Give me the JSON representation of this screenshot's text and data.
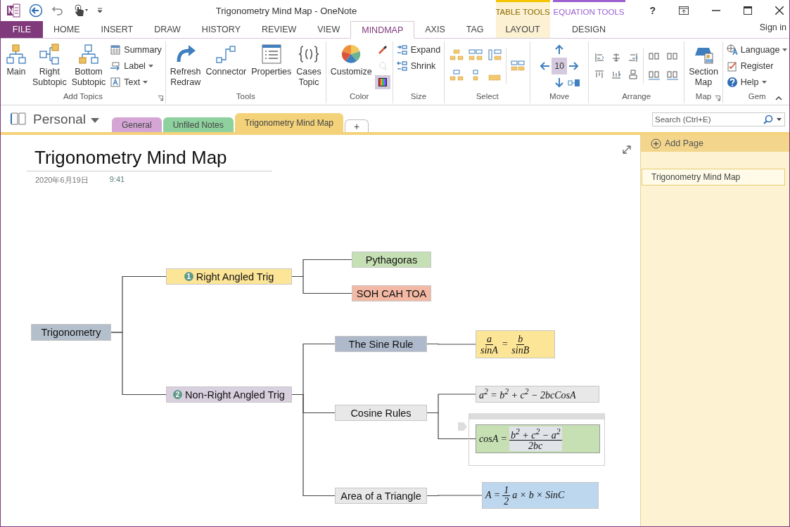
{
  "window": {
    "title": "Trigonometry Mind Map - OneNote",
    "help": "?",
    "sign_in": "Sign in"
  },
  "tabs": [
    {
      "label": "FILE",
      "kind": "file",
      "selected": false
    },
    {
      "label": "HOME",
      "kind": "normal",
      "selected": false
    },
    {
      "label": "INSERT",
      "kind": "normal",
      "selected": false
    },
    {
      "label": "DRAW",
      "kind": "normal",
      "selected": false
    },
    {
      "label": "HISTORY",
      "kind": "normal",
      "selected": false
    },
    {
      "label": "REVIEW",
      "kind": "normal",
      "selected": false
    },
    {
      "label": "VIEW",
      "kind": "normal",
      "selected": false
    },
    {
      "label": "MINDMAP",
      "kind": "normal",
      "selected": true
    },
    {
      "label": "AXIS",
      "kind": "normal",
      "selected": false
    },
    {
      "label": "TAG",
      "kind": "normal",
      "selected": false
    }
  ],
  "context_groups": [
    {
      "label": "TABLE TOOLS",
      "color": "#f5c400",
      "tabs": [
        {
          "label": "LAYOUT",
          "selected": false
        }
      ]
    },
    {
      "label": "EQUATION TOOLS",
      "color": "#9b5fd0",
      "tabs": [
        {
          "label": "DESIGN",
          "selected": false
        }
      ]
    }
  ],
  "ribbon": {
    "groups": [
      {
        "label": "Add Topics",
        "launcher": true,
        "items": [
          {
            "kind": "large",
            "lines": [
              "Main"
            ]
          },
          {
            "kind": "large",
            "lines": [
              "Right",
              "Subtopic"
            ]
          },
          {
            "kind": "large",
            "lines": [
              "Bottom",
              "Subtopic"
            ]
          },
          {
            "kind": "stack",
            "items": [
              {
                "kind": "small",
                "label": "Summary",
                "dropdown": false
              },
              {
                "kind": "small",
                "label": "Label",
                "dropdown": true
              },
              {
                "kind": "small",
                "label": "Text",
                "dropdown": true
              }
            ]
          }
        ]
      },
      {
        "label": "Tools",
        "launcher": false,
        "items": [
          {
            "kind": "large",
            "lines": [
              "Refresh",
              "Redraw"
            ]
          },
          {
            "kind": "large",
            "lines": [
              "Connector"
            ]
          },
          {
            "kind": "large",
            "lines": [
              "Properties"
            ]
          },
          {
            "kind": "large",
            "lines": [
              "Cases",
              "Topic"
            ]
          }
        ]
      },
      {
        "label": "Color",
        "launcher": false,
        "items": [
          {
            "kind": "large",
            "lines": [
              "Customize"
            ]
          },
          {
            "kind": "stack",
            "items": [
              {
                "kind": "icon",
                "disabled": false,
                "selected": false
              },
              {
                "kind": "icon",
                "disabled": true,
                "selected": false
              },
              {
                "kind": "icon",
                "disabled": false,
                "selected": true
              }
            ]
          }
        ]
      },
      {
        "label": "Size",
        "launcher": false,
        "items": [
          {
            "kind": "stack",
            "items": [
              {
                "kind": "small",
                "label": "Expand",
                "dropdown": false
              },
              {
                "kind": "small",
                "label": "Shrink",
                "dropdown": false
              }
            ]
          }
        ]
      },
      {
        "label": "Select",
        "launcher": false,
        "items": [
          {
            "kind": "iconset"
          }
        ]
      },
      {
        "label": "Move",
        "launcher": false,
        "items": [
          {
            "kind": "nudge",
            "value": "10"
          }
        ]
      },
      {
        "label": "Arrange",
        "launcher": false,
        "items": [
          {
            "kind": "iconset"
          }
        ]
      },
      {
        "label": "Map",
        "launcher": true,
        "items": [
          {
            "kind": "large",
            "lines": [
              "Section",
              "Map"
            ]
          }
        ]
      },
      {
        "label": "Gem",
        "launcher": false,
        "items": [
          {
            "kind": "stack",
            "items": [
              {
                "kind": "small",
                "label": "Language",
                "dropdown": true
              },
              {
                "kind": "small",
                "label": "Register",
                "dropdown": false
              },
              {
                "kind": "small",
                "label": "Help",
                "dropdown": true
              }
            ]
          }
        ]
      }
    ]
  },
  "notebook": {
    "name": "Personal",
    "sections": [
      {
        "label": "General",
        "color": "#d5a6d5",
        "selected": false
      },
      {
        "label": "Unfiled Notes",
        "color": "#8fd19e",
        "selected": false
      },
      {
        "label": "Trigonometry Mind Map",
        "color": "#f3d27a",
        "selected": true
      }
    ],
    "add_section": "+"
  },
  "search": {
    "placeholder": "Search (Ctrl+E)"
  },
  "page": {
    "title": "Trigonometry Mind Map",
    "date": "2020年6月19日",
    "time": "9:41"
  },
  "mind_map": {
    "root": {
      "kind": "topic",
      "text": "Trigonometry",
      "color": "#b4bfcc",
      "selected": false,
      "children": [
        {
          "kind": "topic",
          "text": "Right Angled Trig",
          "badge": "1",
          "color": "#fde597",
          "selected": false,
          "children": [
            {
              "kind": "topic",
              "text": "Pythagoras",
              "color": "#c5e0b4",
              "selected": false
            },
            {
              "kind": "topic",
              "text": "SOH CAH TOA",
              "color": "#f4b9a5",
              "selected": false
            }
          ]
        },
        {
          "kind": "topic",
          "text": "Non-Right Angled Trig",
          "badge": "2",
          "color": "#d9d0df",
          "selected": false,
          "children": [
            {
              "kind": "topic",
              "text": "The Sine Rule",
              "color": "#aebacb",
              "selected": false,
              "children": [
                {
                  "kind": "equation",
                  "color": "#fde597",
                  "selected": false,
                  "terms": [
                    {
                      "kind": "frac",
                      "num": "a",
                      "den": "sinA"
                    },
                    {
                      "kind": "text",
                      "text": "="
                    },
                    {
                      "kind": "frac",
                      "num": "b",
                      "den": "sinB"
                    }
                  ]
                }
              ]
            },
            {
              "kind": "topic",
              "text": "Cosine Rules",
              "color": "#e8e8e8",
              "selected": false,
              "children": [
                {
                  "kind": "equation",
                  "color": "#e8e8e8",
                  "selected": false,
                  "terms": [
                    {
                      "kind": "text",
                      "text": "a$^{2}$ = b$^{2}$ + c$^{2}$ − 2bcCosA"
                    }
                  ]
                },
                {
                  "kind": "equation",
                  "color": "#c6e0b4",
                  "selected": true,
                  "terms": [
                    {
                      "kind": "text",
                      "text": "cosA ="
                    },
                    {
                      "kind": "frac",
                      "num": "b$^{2}$ + c$^{2}$ − a$^{2}$",
                      "den": "2bc"
                    }
                  ]
                }
              ]
            },
            {
              "kind": "topic",
              "text": "Area of a Triangle",
              "color": "#e8e8e8",
              "selected": false,
              "children": [
                {
                  "kind": "equation",
                  "color": "#bdd7ee",
                  "selected": false,
                  "terms": [
                    {
                      "kind": "text",
                      "text": "A ="
                    },
                    {
                      "kind": "frac",
                      "num": "1",
                      "den": "2"
                    },
                    {
                      "kind": "text",
                      "text": "a × b × SinC"
                    }
                  ]
                }
              ]
            }
          ]
        }
      ]
    }
  },
  "pages": {
    "add_page": "Add Page",
    "items": [
      {
        "title": "Trigonometry Mind Map",
        "selected": true
      }
    ]
  }
}
